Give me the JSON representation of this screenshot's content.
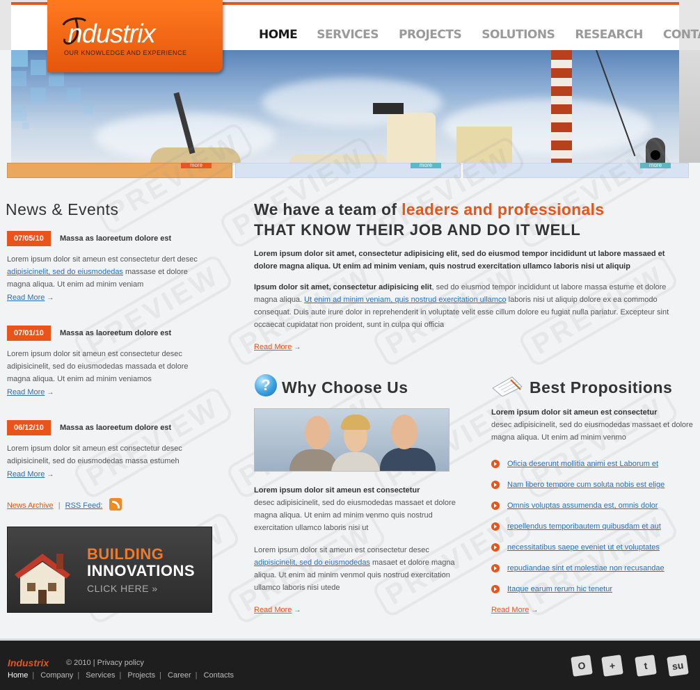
{
  "logo": {
    "name": "Industrix",
    "tagline": "OUR KNOWLEDGE AND EXPERIENCE"
  },
  "nav": [
    {
      "label": "HOME",
      "active": true
    },
    {
      "label": "SERVICES"
    },
    {
      "label": "PROJECTS"
    },
    {
      "label": "SOLUTIONS"
    },
    {
      "label": "RESEARCH"
    },
    {
      "label": "CONTACTS"
    }
  ],
  "tabs": [
    {
      "more": "more",
      "color": "#e8541a"
    },
    {
      "more": "more",
      "color": "#5bb8c4"
    },
    {
      "more": "more",
      "color": "#5bb8c4"
    }
  ],
  "news": {
    "heading": "News & Events",
    "items": [
      {
        "date": "07/05/10",
        "title": "Massa as laoreetum dolore est",
        "text_a": "Lorem ipsum dolor sit ameun est  consectetur dert desec ",
        "link": "adipisicinelit, sed do eiusmodedas",
        "text_b": " massase et dolore magna aliqua. Ut enim ad minim veniam",
        "read_more": "Read More"
      },
      {
        "date": "07/01/10",
        "title": "Massa as laoreetum dolore est",
        "text": "Lorem ipsum dolor sit ameun est  consectetur desec adipisicinelit, sed do eiusmodedas massada et dolore magna aliqua. Ut enim ad minim veniamos",
        "read_more": "Read More"
      },
      {
        "date": "06/12/10",
        "title": "Massa as laoreetum dolore est",
        "text": "Lorem ipsum dolor sit ameun est  consectetur desec adipisicinelit, sed do eiusmodedas massa estumeh",
        "read_more": "Read More"
      }
    ],
    "archive_label": "News Archive",
    "rss_label": "RSS Feed:",
    "separator": "|"
  },
  "promo": {
    "line1": "BUILDING",
    "line2": "INNOVATIONS",
    "line3": "CLICK HERE »"
  },
  "team": {
    "heading_a": "We have a team of ",
    "heading_accent": "leaders and professionals",
    "heading_b": "THAT KNOW THEIR JOB AND DO IT WELL",
    "bold": "Lorem ipsum dolor sit amet, consectetur adipisicing elit, sed do eiusmod tempor incididunt ut labore massaed et dolore magna aliqua. Ut enim ad minim veniam, quis nostrud exercitation ullamco laboris nisi ut aliquip",
    "p_bold": "Ipsum dolor sit amet, consectetur adipisicing elit",
    "p_a": ", sed do eiusmod tempor incididunt ut labore massa estume et dolore magna aliqua. ",
    "p_link": "Ut enim ad minim veniam, quis nostrud exercitation ullamco",
    "p_b": " laboris nisi ut aliquip dolore ex ea commodo consequat. Duis aute irure dolor in reprehenderit in voluptate velit esse cillum dolore eu fugiat nulla pariatur. Excepteur sint occaecat cupidatat non proident, sunt in culpa qui officia",
    "read_more": "Read More"
  },
  "why": {
    "heading": "Why Choose Us",
    "bold": "Lorem ipsum dolor sit ameun est  consectetur",
    "text": "desec adipisicinelit, sed do eiusmodedas massaet et dolore magna aliqua. Ut enim ad minim venmo quis nostrud exercitation ullamco laboris nisi ut",
    "p2_a": "Lorem ipsum dolor sit ameun est  consectetur desec ",
    "p2_link": "adipisicinelit, sed do eiusmodedas",
    "p2_b": " masaet et dolore magna aliqua. Ut enim ad minim venmol quis nostrud exercitation ullamco laboris nisi utede",
    "read_more": "Read More"
  },
  "best": {
    "heading": "Best Propositions",
    "bold": "Lorem ipsum dolor sit ameun est  consectetur",
    "text": "desec adipisicinelit, sed do eiusmodedas massaet et dolore magna aliqua. Ut enim ad minim venmo",
    "items": [
      "Oficia deserunt mollitia animi est Laborum et",
      "Nam libero tempore cum soluta nobis est elige",
      "Omnis voluptas assumenda est, omnis dolor",
      "repellendus temporibautem quibusdam et aut",
      "necessitatibus saepe eveniet ut et voluptates",
      "repudiandae sint et molestiae non recusandae",
      "Itaque earum rerum hic tenetur"
    ],
    "read_more": "Read More"
  },
  "footer": {
    "logo": "Industrix",
    "copyright": "© 2010 | Privacy policy",
    "links": [
      "Home",
      "Company",
      "Services",
      "Projects",
      "Career",
      "Contacts"
    ],
    "social": [
      "O",
      "+",
      "t",
      "su"
    ]
  },
  "watermark": "PREVIEW"
}
